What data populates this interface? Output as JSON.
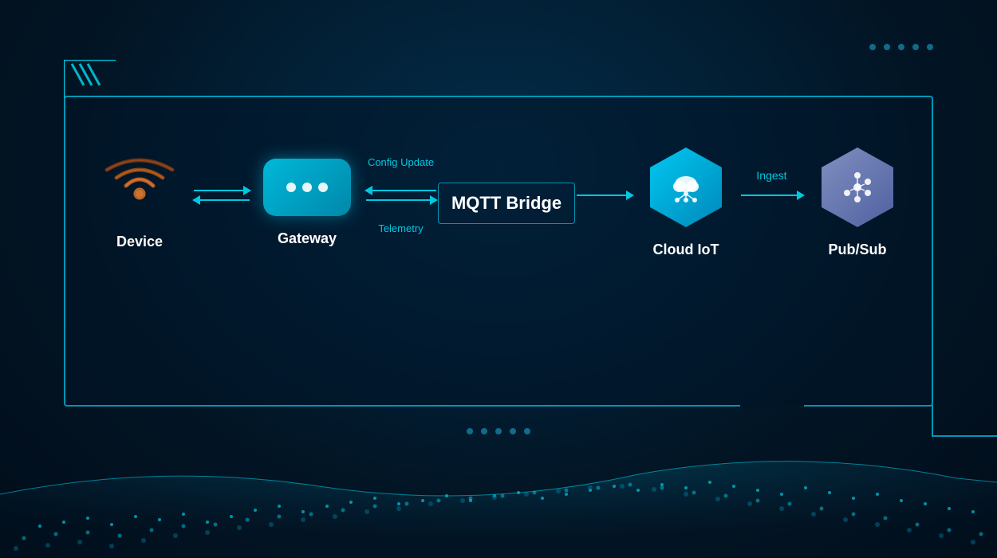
{
  "background": {
    "color": "#021a2e"
  },
  "dots_top_right": {
    "count": 5
  },
  "dots_bottom_center": {
    "count": 5
  },
  "diagram": {
    "nodes": [
      {
        "id": "device",
        "label": "Device",
        "icon_type": "wifi"
      },
      {
        "id": "gateway",
        "label": "Gateway",
        "icon_type": "box"
      },
      {
        "id": "mqtt-bridge",
        "label": "MQTT Bridge",
        "icon_type": "text"
      },
      {
        "id": "cloud-iot",
        "label": "Cloud IoT",
        "icon_type": "hexagon-cloud"
      },
      {
        "id": "pubsub",
        "label": "Pub/Sub",
        "icon_type": "hexagon-pubsub"
      }
    ],
    "arrows": [
      {
        "id": "device-gateway",
        "type": "double",
        "from": "device",
        "to": "gateway",
        "label_top": null,
        "label_bottom": null
      },
      {
        "id": "gateway-mqtt",
        "type": "double-labeled",
        "from": "gateway",
        "to": "mqtt-bridge",
        "label_top": "Config Update",
        "label_bottom": "Telemetry"
      },
      {
        "id": "mqtt-cloudiot",
        "type": "single",
        "from": "mqtt-bridge",
        "to": "cloud-iot",
        "label_top": null,
        "label_bottom": null
      },
      {
        "id": "cloudiot-pubsub",
        "type": "single-labeled",
        "from": "cloud-iot",
        "to": "pubsub",
        "label_top": "Ingest",
        "label_bottom": null
      }
    ]
  }
}
